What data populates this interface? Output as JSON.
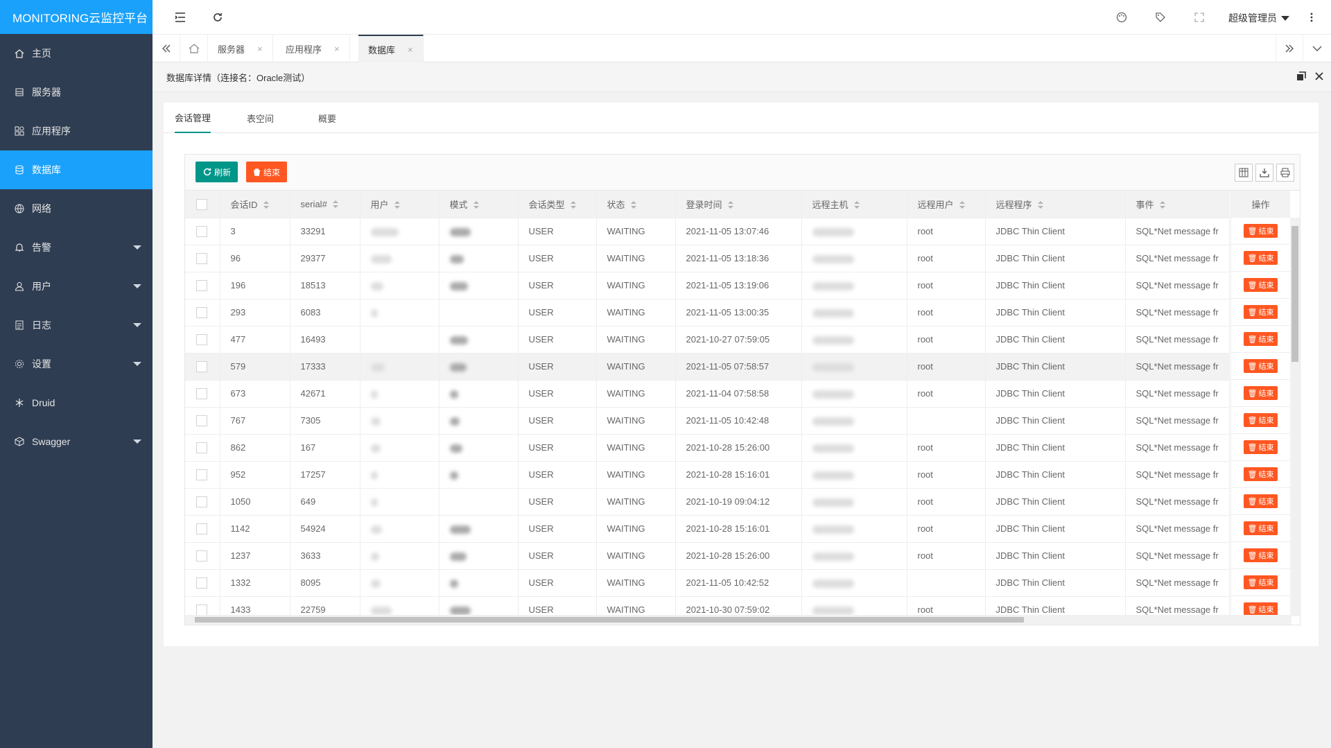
{
  "app": {
    "title": "MONITORING云监控平台"
  },
  "sidebar": {
    "items": [
      {
        "label": "主页",
        "icon": "home-icon",
        "expandable": false,
        "active": false
      },
      {
        "label": "服务器",
        "icon": "server-icon",
        "expandable": false,
        "active": false
      },
      {
        "label": "应用程序",
        "icon": "app-icon",
        "expandable": false,
        "active": false
      },
      {
        "label": "数据库",
        "icon": "database-icon",
        "expandable": false,
        "active": true
      },
      {
        "label": "网络",
        "icon": "globe-icon",
        "expandable": false,
        "active": false
      },
      {
        "label": "告警",
        "icon": "bell-icon",
        "expandable": true,
        "active": false
      },
      {
        "label": "用户",
        "icon": "user-icon",
        "expandable": true,
        "active": false
      },
      {
        "label": "日志",
        "icon": "log-icon",
        "expandable": true,
        "active": false
      },
      {
        "label": "设置",
        "icon": "gear-icon",
        "expandable": true,
        "active": false
      },
      {
        "label": "Druid",
        "icon": "snowflake-icon",
        "expandable": false,
        "active": false
      },
      {
        "label": "Swagger",
        "icon": "cube-icon",
        "expandable": true,
        "active": false
      }
    ]
  },
  "header": {
    "user_label": "超级管理员"
  },
  "tabs": [
    {
      "label": "服务器",
      "active": false
    },
    {
      "label": "应用程序",
      "active": false
    },
    {
      "label": "数据库",
      "active": true
    }
  ],
  "page": {
    "title": "数据库详情（连接名：Oracle测试）"
  },
  "subtabs": [
    "会话管理",
    "表空间",
    "概要"
  ],
  "toolbar": {
    "refresh_label": "刷新",
    "end_label": "结束"
  },
  "table": {
    "columns": [
      "会话ID",
      "serial#",
      "用户",
      "模式",
      "会话类型",
      "状态",
      "登录时间",
      "远程主机",
      "远程用户",
      "远程程序",
      "事件"
    ],
    "action_header": "操作",
    "row_action_label": "结束",
    "rows": [
      {
        "id": "3",
        "serial": "33291",
        "type": "USER",
        "status": "WAITING",
        "login": "2021-11-05 13:07:46",
        "ruser": "root",
        "program": "JDBC Thin Client",
        "event": "SQL*Net message fr"
      },
      {
        "id": "96",
        "serial": "29377",
        "type": "USER",
        "status": "WAITING",
        "login": "2021-11-05 13:18:36",
        "ruser": "root",
        "program": "JDBC Thin Client",
        "event": "SQL*Net message fr"
      },
      {
        "id": "196",
        "serial": "18513",
        "type": "USER",
        "status": "WAITING",
        "login": "2021-11-05 13:19:06",
        "ruser": "root",
        "program": "JDBC Thin Client",
        "event": "SQL*Net message fr"
      },
      {
        "id": "293",
        "serial": "6083",
        "type": "USER",
        "status": "WAITING",
        "login": "2021-11-05 13:00:35",
        "ruser": "root",
        "program": "JDBC Thin Client",
        "event": "SQL*Net message fr"
      },
      {
        "id": "477",
        "serial": "16493",
        "type": "USER",
        "status": "WAITING",
        "login": "2021-10-27 07:59:05",
        "ruser": "root",
        "program": "JDBC Thin Client",
        "event": "SQL*Net message fr"
      },
      {
        "id": "579",
        "serial": "17333",
        "type": "USER",
        "status": "WAITING",
        "login": "2021-11-05 07:58:57",
        "ruser": "root",
        "program": "JDBC Thin Client",
        "event": "SQL*Net message fr"
      },
      {
        "id": "673",
        "serial": "42671",
        "type": "USER",
        "status": "WAITING",
        "login": "2021-11-04 07:58:58",
        "ruser": "root",
        "program": "JDBC Thin Client",
        "event": "SQL*Net message fr"
      },
      {
        "id": "767",
        "serial": "7305",
        "type": "USER",
        "status": "WAITING",
        "login": "2021-11-05 10:42:48",
        "ruser": "",
        "program": "JDBC Thin Client",
        "event": "SQL*Net message fr"
      },
      {
        "id": "862",
        "serial": "167",
        "type": "USER",
        "status": "WAITING",
        "login": "2021-10-28 15:26:00",
        "ruser": "root",
        "program": "JDBC Thin Client",
        "event": "SQL*Net message fr"
      },
      {
        "id": "952",
        "serial": "17257",
        "type": "USER",
        "status": "WAITING",
        "login": "2021-10-28 15:16:01",
        "ruser": "root",
        "program": "JDBC Thin Client",
        "event": "SQL*Net message fr"
      },
      {
        "id": "1050",
        "serial": "649",
        "type": "USER",
        "status": "WAITING",
        "login": "2021-10-19 09:04:12",
        "ruser": "root",
        "program": "JDBC Thin Client",
        "event": "SQL*Net message fr"
      },
      {
        "id": "1142",
        "serial": "54924",
        "type": "USER",
        "status": "WAITING",
        "login": "2021-10-28 15:16:01",
        "ruser": "root",
        "program": "JDBC Thin Client",
        "event": "SQL*Net message fr"
      },
      {
        "id": "1237",
        "serial": "3633",
        "type": "USER",
        "status": "WAITING",
        "login": "2021-10-28 15:26:00",
        "ruser": "root",
        "program": "JDBC Thin Client",
        "event": "SQL*Net message fr"
      },
      {
        "id": "1332",
        "serial": "8095",
        "type": "USER",
        "status": "WAITING",
        "login": "2021-11-05 10:42:52",
        "ruser": "",
        "program": "JDBC Thin Client",
        "event": "SQL*Net message fr"
      },
      {
        "id": "1433",
        "serial": "22759",
        "type": "USER",
        "status": "WAITING",
        "login": "2021-10-30 07:59:02",
        "ruser": "root",
        "program": "JDBC Thin Client",
        "event": "SQL*Net message fr"
      }
    ]
  },
  "colors": {
    "sidebar_bg": "#2f3d52",
    "accent": "#1aa1fb",
    "refresh_btn": "#009688",
    "danger": "#ff5722"
  }
}
